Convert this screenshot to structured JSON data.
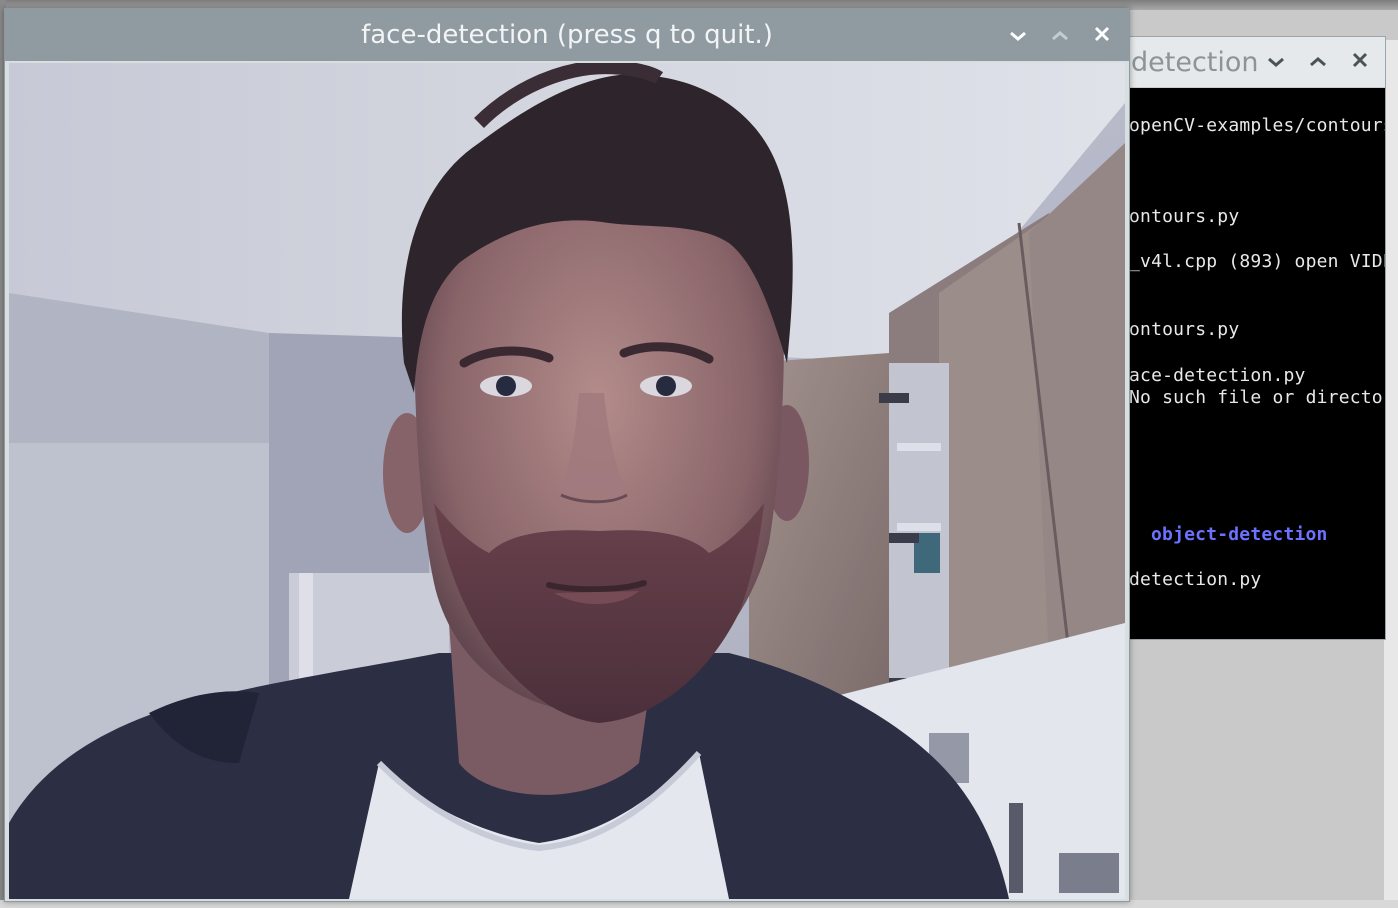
{
  "camera_window": {
    "title": "face-detection (press q to quit.)",
    "controls": [
      "minimize",
      "maximize",
      "close"
    ]
  },
  "terminal_window": {
    "title": "detection",
    "lines": [
      "openCV-examples/contours",
      "ontours.py",
      "_v4l.cpp (893) open VIDE",
      "ontours.py",
      "ace-detection.py",
      "No such file or director",
      "object-detection",
      "detection.py"
    ]
  },
  "colors": {
    "titlebar_active": "#8f9ba1",
    "titlebar_inactive": "#e6e9eb",
    "terminal_bg": "#000000",
    "terminal_text": "#e8e8e8",
    "terminal_dir": "#6b72ff"
  },
  "icons": {
    "minimize": "chevron-down-icon",
    "maximize": "chevron-up-icon",
    "close": "close-icon"
  }
}
